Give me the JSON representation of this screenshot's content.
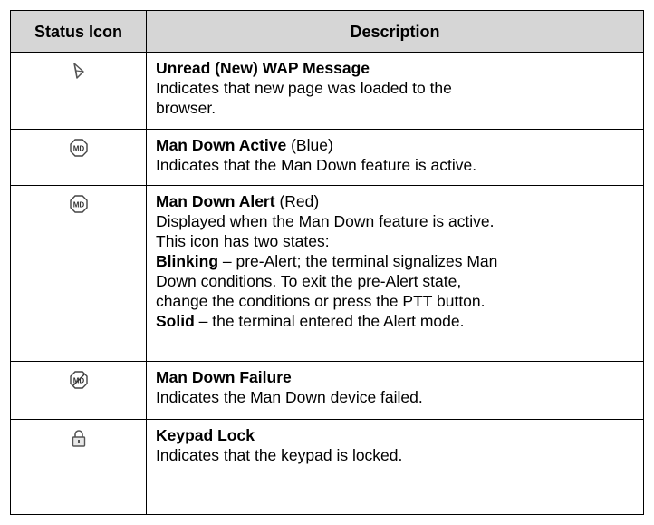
{
  "headers": {
    "icon": "Status Icon",
    "description": "Description"
  },
  "rows": [
    {
      "icon": "wap-message-icon",
      "title": "Unread (New) WAP Message",
      "l1": "Indicates that new page was loaded to the",
      "l2": "browser."
    },
    {
      "icon": "man-down-active-icon",
      "title": "Man Down Active",
      "title_note": " (Blue)",
      "l1": "Indicates that the Man Down feature is active."
    },
    {
      "icon": "man-down-alert-icon",
      "title": "Man Down Alert",
      "title_note": " (Red)",
      "l1": "Displayed when the Man Down feature is active.",
      "l2": "This icon has two states:",
      "blink_label": "Blinking",
      "blink_l1": " – pre-Alert; the terminal signalizes Man",
      "blink_l2": "Down conditions. To exit the pre-Alert state,",
      "blink_l3": "change the conditions or press the PTT button.",
      "solid_label": "Solid",
      "solid_text": " – the terminal entered the Alert mode."
    },
    {
      "icon": "man-down-failure-icon",
      "title": "Man Down Failure",
      "l1": "Indicates the Man Down device failed."
    },
    {
      "icon": "keypad-lock-icon",
      "title": "Keypad Lock",
      "l1": "Indicates that the keypad is locked."
    }
  ]
}
